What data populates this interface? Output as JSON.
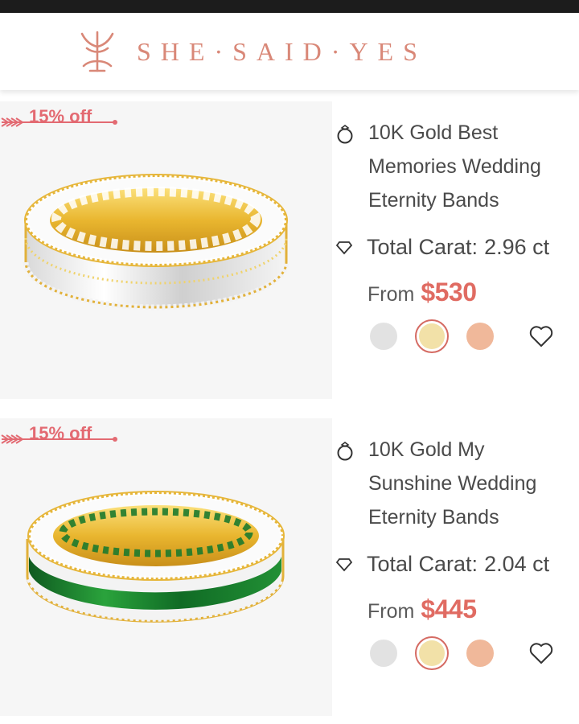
{
  "header": {
    "brand": "SHE·SAID·YES"
  },
  "products": [
    {
      "discount": "15% off",
      "title": "10K Gold Best Memories Wedding Eternity Bands",
      "carat_label": "Total Carat:",
      "carat_value": "2.96 ct",
      "from_label": "From",
      "price": "$530",
      "stone": "white",
      "swatches": [
        {
          "name": "white-gold",
          "color": "#e2e2e2"
        },
        {
          "name": "yellow-gold",
          "color": "#f2e1a8",
          "selected": true
        },
        {
          "name": "rose-gold",
          "color": "#f0b89a"
        }
      ]
    },
    {
      "discount": "15% off",
      "title": "10K Gold My Sunshine Wedding Eternity Bands",
      "carat_label": "Total Carat:",
      "carat_value": "2.04 ct",
      "from_label": "From",
      "price": "$445",
      "stone": "emerald",
      "swatches": [
        {
          "name": "white-gold",
          "color": "#e2e2e2"
        },
        {
          "name": "yellow-gold",
          "color": "#f2e1a8",
          "selected": true
        },
        {
          "name": "rose-gold",
          "color": "#f0b89a"
        }
      ]
    }
  ],
  "colors": {
    "brand": "#d98878",
    "price": "#e06b62",
    "discount": "#e36a72",
    "text": "#4a4a4a"
  },
  "icons": [
    "logo-mark",
    "ring-icon",
    "diamond-icon",
    "heart-icon",
    "arrow-icon"
  ]
}
